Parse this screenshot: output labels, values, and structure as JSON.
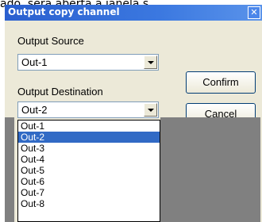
{
  "background": {
    "text": "ado, será aberta a janela s"
  },
  "dialog": {
    "title": "Output copy channel",
    "close_glyph": "✕",
    "source_label": "Output Source",
    "source_value": "Out-1",
    "destination_label": "Output Destination",
    "destination_value": "Out-2",
    "confirm_label": "Confirm",
    "cancel_label": "Cancel"
  },
  "dropdown": {
    "options": [
      "Out-1",
      "Out-2",
      "Out-3",
      "Out-4",
      "Out-5",
      "Out-6",
      "Out-7",
      "Out-8"
    ],
    "selected": "Out-2"
  },
  "colors": {
    "title_bar": "#3b78e0",
    "selection": "#316ac5",
    "dialog_face": "#ece9d8"
  }
}
